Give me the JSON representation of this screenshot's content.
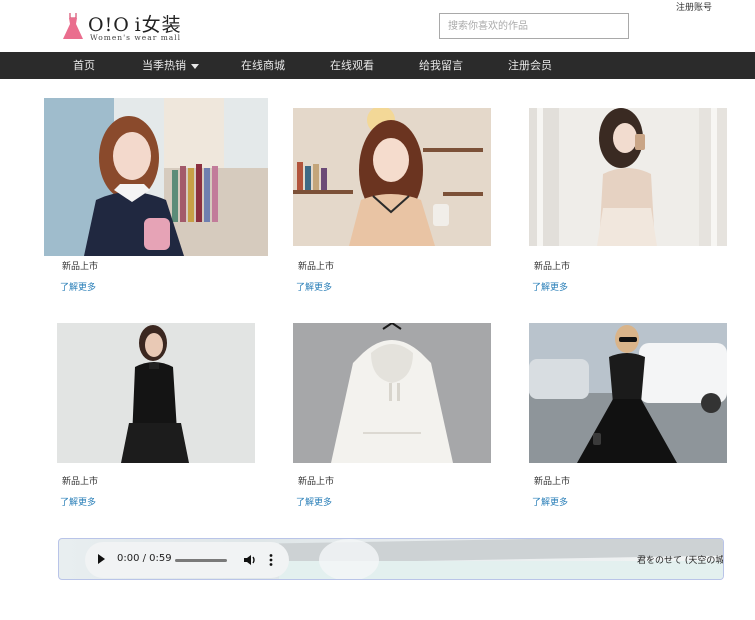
{
  "header": {
    "brand_name": "O!O i女装",
    "brand_sub": "Women's wear mall",
    "search_placeholder": "搜索你喜欢的作品",
    "register_link": "注册账号"
  },
  "nav": {
    "items": [
      {
        "label": "首页"
      },
      {
        "label": "当季热销",
        "has_dropdown": true
      },
      {
        "label": "在线商城"
      },
      {
        "label": "在线观看"
      },
      {
        "label": "给我留言"
      },
      {
        "label": "注册会员"
      }
    ]
  },
  "products": [
    {
      "title": "新品上市",
      "more": "了解更多"
    },
    {
      "title": "新品上市",
      "more": "了解更多"
    },
    {
      "title": "新品上市",
      "more": "了解更多"
    },
    {
      "title": "新品上市",
      "more": "了解更多"
    },
    {
      "title": "新品上市",
      "more": "了解更多"
    },
    {
      "title": "新品上市",
      "more": "了解更多"
    }
  ],
  "music": {
    "time": "0:00 / 0:59",
    "progress_fraction": 0,
    "marquee": "君をのせて (天空の城"
  },
  "colors": {
    "nav_bg": "#2b2b2b",
    "link": "#2a7fb8",
    "logo_dress": "#e86a8a"
  }
}
